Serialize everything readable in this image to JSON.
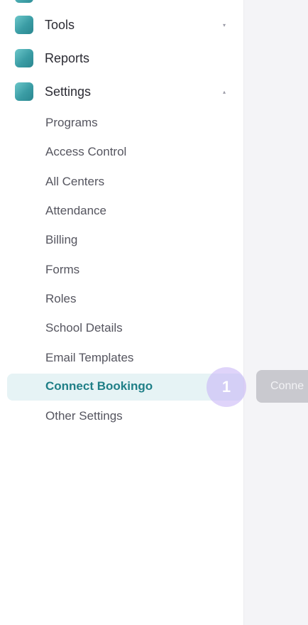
{
  "sidebar": {
    "nav": [
      {
        "label": "Tools",
        "caret": "▾"
      },
      {
        "label": "Reports",
        "caret": ""
      },
      {
        "label": "Settings",
        "caret": "▴"
      }
    ],
    "settings_items": [
      {
        "label": "Programs",
        "active": false
      },
      {
        "label": "Access Control",
        "active": false
      },
      {
        "label": "All Centers",
        "active": false
      },
      {
        "label": "Attendance",
        "active": false
      },
      {
        "label": "Billing",
        "active": false
      },
      {
        "label": "Forms",
        "active": false
      },
      {
        "label": "Roles",
        "active": false
      },
      {
        "label": "School Details",
        "active": false
      },
      {
        "label": "Email Templates",
        "active": false
      },
      {
        "label": "Connect Bookingo",
        "active": true
      },
      {
        "label": "Other Settings",
        "active": false
      }
    ]
  },
  "guide": {
    "step_number": "1",
    "button_label": "Conne"
  },
  "colors": {
    "accent": "#1f7f87",
    "active_bg": "#e6f3f5",
    "step_badge": "#c4b0f6"
  }
}
